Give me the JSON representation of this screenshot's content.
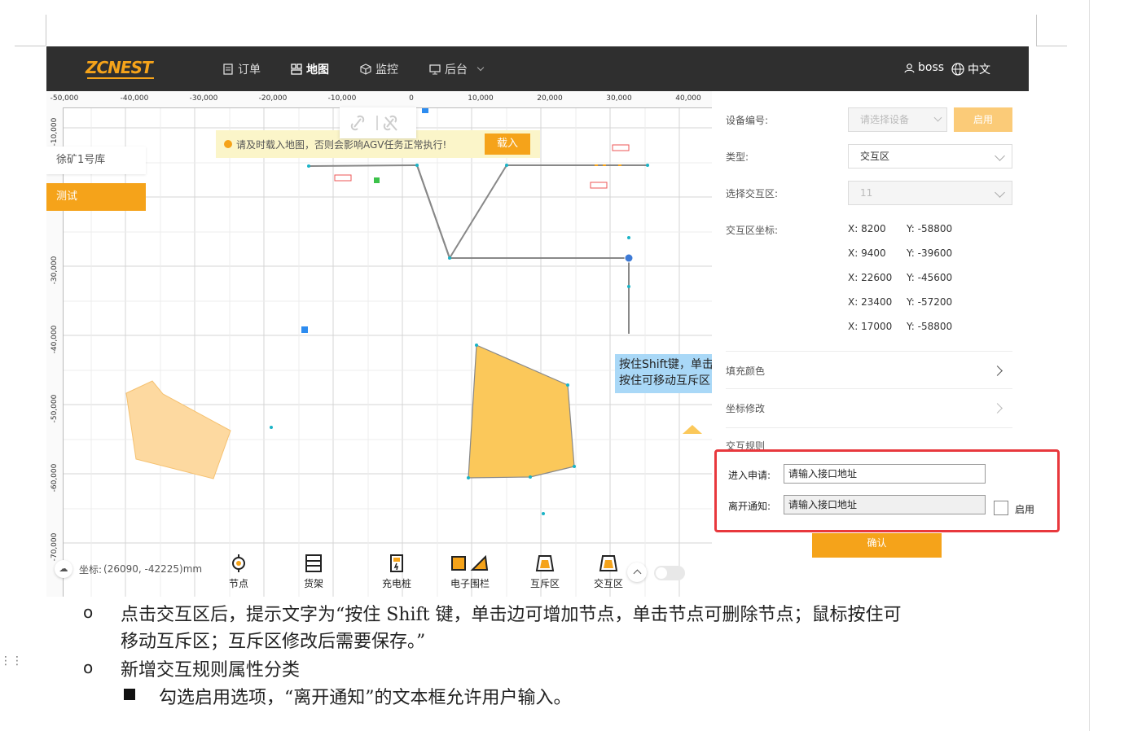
{
  "header": {
    "logo": "ZCNEST",
    "nav": [
      {
        "label": "订单",
        "icon": "document-icon"
      },
      {
        "label": "地图",
        "icon": "map-grid-icon"
      },
      {
        "label": "监控",
        "icon": "cube-icon"
      },
      {
        "label": "后台",
        "icon": "monitor-icon"
      }
    ],
    "user": "boss",
    "language": "中文"
  },
  "map": {
    "ruler_x": [
      "-50,000",
      "-40,000",
      "-30,000",
      "-20,000",
      "-10,000",
      "0",
      "10,000",
      "20,000",
      "30,000",
      "40,000"
    ],
    "ruler_y": [
      "-10,000",
      "-30,000",
      "-40,000",
      "-50,000",
      "-60,000",
      "-70,000"
    ],
    "warehouses": [
      "徐矿1号库",
      "测试"
    ],
    "warning": "请及时载入地图，否则会影响AGV任务正常执行!",
    "load_button": "载入",
    "tooltip_line1": "按住Shift键，单击",
    "tooltip_line2": "按住可移动互斥区",
    "coordinate_label": "坐标:",
    "coordinate_value": "(26090, -42225)mm",
    "tools": [
      "节点",
      "货架",
      "充电桩",
      "电子围栏",
      "互斥区",
      "交互区"
    ]
  },
  "panel": {
    "device_label": "设备编号:",
    "device_placeholder": "请选择设备",
    "enable_button": "启用",
    "type_label": "类型:",
    "type_value": "交互区",
    "zone_label": "选择交互区:",
    "zone_value": "11",
    "coords_label": "交互区坐标:",
    "coords": [
      {
        "x": "8200",
        "y": "-58800"
      },
      {
        "x": "9400",
        "y": "-39600"
      },
      {
        "x": "22600",
        "y": "-45600"
      },
      {
        "x": "23400",
        "y": "-57200"
      },
      {
        "x": "17000",
        "y": "-58800"
      }
    ],
    "x_prefix": "X:",
    "y_prefix": "Y:",
    "fill_color": "填充颜色",
    "coord_edit": "坐标修改",
    "rules": "交互规则",
    "enter_label": "进入申请:",
    "enter_value": "请输入接口地址",
    "leave_label": "离开通知:",
    "leave_value": "请输入接口地址",
    "leave_enable": "启用",
    "confirm": "确认"
  },
  "doc": {
    "line1": "点击交互区后，提示文字为“按住 Shift 键，单击边可增加节点，单击节点可删除节点；鼠标按住可",
    "line2": "移动互斥区；互斥区修改后需要保存。”",
    "line3": "新增交互规则属性分类",
    "line4": "勾选启用选项，“离开通知”的文本框允许用户输入。"
  },
  "colors": {
    "accent": "#f5a31a",
    "highlight": "#e8383d",
    "topbar": "#2f2f2f"
  }
}
